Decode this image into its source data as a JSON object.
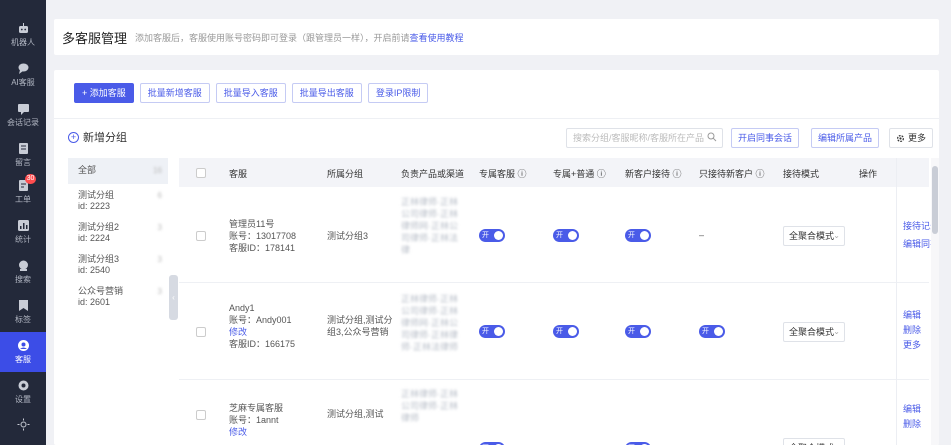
{
  "sidebar": {
    "items": [
      {
        "label": "机器人",
        "icon": "robot-icon"
      },
      {
        "label": "AI客服",
        "icon": "chat-bubble-icon"
      },
      {
        "label": "会话记录",
        "icon": "message-icon"
      },
      {
        "label": "留言",
        "icon": "note-icon"
      },
      {
        "label": "工单",
        "icon": "ticket-icon",
        "badge": "30"
      },
      {
        "label": "统计",
        "icon": "chart-icon"
      },
      {
        "label": "搜索",
        "icon": "search-icon"
      },
      {
        "label": "标签",
        "icon": "bookmark-icon"
      },
      {
        "label": "客服",
        "icon": "agent-icon",
        "active": true
      },
      {
        "label": "设置",
        "icon": "settings-icon"
      },
      {
        "label": "",
        "icon": "sun-icon"
      }
    ]
  },
  "header": {
    "title": "多客服管理",
    "tip": "添加客服后，客服使用账号密码即可登录（跟管理员一样），开启前请",
    "link": "查看使用教程"
  },
  "toolbar": {
    "add": "+ 添加客服",
    "batch_add": "批量新增客服",
    "batch_import": "批量导入客服",
    "batch_export": "批量导出客服",
    "ip_limit": "登录IP限制"
  },
  "groups": {
    "add_label": "新增分组",
    "items": [
      {
        "name": "全部",
        "id": "",
        "count": "16",
        "selected": true
      },
      {
        "name": "测试分组",
        "id": "id: 2223",
        "count": "6"
      },
      {
        "name": "测试分组2",
        "id": "id: 2224",
        "count": "3"
      },
      {
        "name": "测试分组3",
        "id": "id: 2540",
        "count": "3"
      },
      {
        "name": "公众号营销",
        "id": "id: 2601",
        "count": "3"
      }
    ]
  },
  "search": {
    "placeholder": "搜索分组/客服昵称/客服所在产品"
  },
  "actions": {
    "colleague": "开启同事会话",
    "edit_product": "编辑所属产品",
    "more": "更多"
  },
  "table": {
    "headers": [
      "客服",
      "所属分组",
      "负责产品或渠道",
      "专属客服 ⓘ",
      "专属+普通 ⓘ",
      "新客户接待 ⓘ",
      "只接待新客户 ⓘ",
      "接待模式",
      "操作"
    ],
    "rows": [
      {
        "name": "管理员11号",
        "account": "账号：13017708",
        "account_link": "",
        "agent_id": "客服ID：178141",
        "group": "测试分组3",
        "products": "正林律师·正林公司律师·正林律师网·正林公司律师·正林法律",
        "dedicated": "开",
        "mixed": "开",
        "newcust": "开",
        "onlynew": "–",
        "mode": "全聚合模式",
        "ops": [
          "接待记录",
          "编辑同事会话"
        ]
      },
      {
        "name": "Andy1",
        "account": "账号：Andy001",
        "account_link": "修改",
        "agent_id": "客服ID：166175",
        "group": "测试分组,测试分组3,公众号营销",
        "products": "正林律师·正林公司律师·正林律师网·正林公司律师·正林律师·正林法律师",
        "dedicated": "开",
        "mixed": "开",
        "newcust": "开",
        "onlynew": "开",
        "mode": "全聚合模式",
        "ops": [
          "编辑",
          "删除",
          "更多"
        ]
      },
      {
        "name": "芝麻专属客服",
        "account": "账号：1annt",
        "account_link": "修改",
        "agent_id": "",
        "group": "测试分组,测试",
        "products": "正林律师·正林公司律师·正林律师",
        "dedicated": "开",
        "mixed": "",
        "newcust": "开",
        "onlynew": "",
        "mode": "全聚合模式",
        "ops": [
          "编辑",
          "删除"
        ]
      }
    ]
  }
}
